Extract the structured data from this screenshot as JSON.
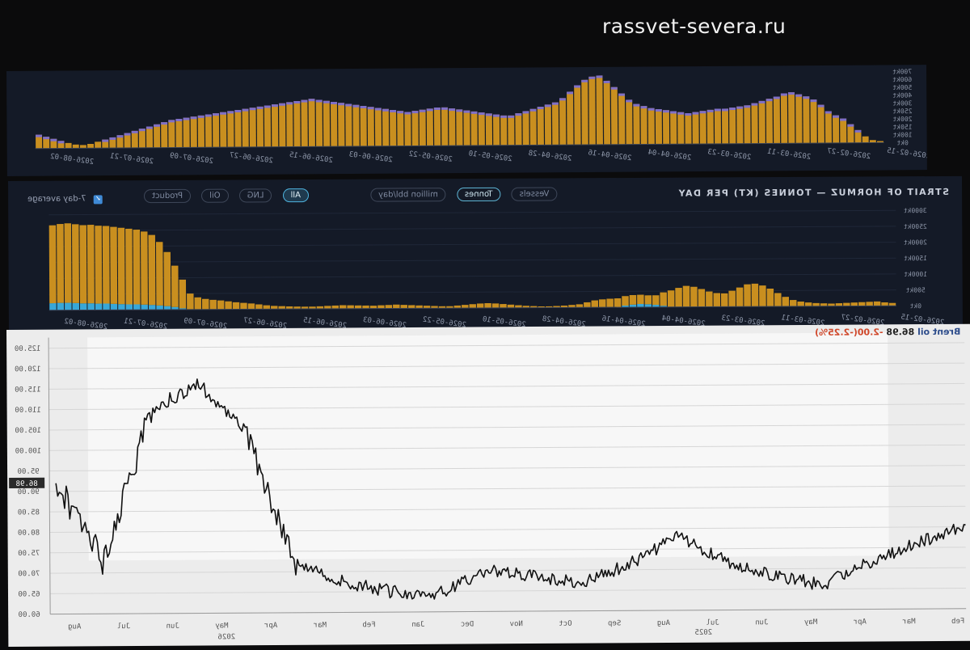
{
  "site": {
    "title": "rassvet-severa.ru"
  },
  "top_chart": {
    "y_ticks": [
      "0kt",
      "100kt",
      "150kt",
      "200kt",
      "250kt",
      "300kt",
      "400kt",
      "500kt",
      "600kt",
      "700kt"
    ],
    "x_ticks": [
      "2026-02-15",
      "2026-02-27",
      "2026-03-11",
      "2026-03-23",
      "2026-04-04",
      "2026-04-16",
      "2026-04-28",
      "2026-05-10",
      "2026-05-22",
      "2026-06-03",
      "2026-06-15",
      "2026-06-27",
      "2026-07-09",
      "2026-07-21",
      "2026-08-02"
    ]
  },
  "mid_chart": {
    "title": "STRAIT OF HORMUZ — TONNES (KT) PER DAY",
    "avg_label": "7-day average",
    "chips": [
      "Vessels",
      "Tonnes",
      "million bbl/day",
      "All",
      "LNG",
      "Oil",
      "Product"
    ],
    "y_ticks": [
      "0kt",
      "500kt",
      "1000kt",
      "1500kt",
      "2000kt",
      "2500kt",
      "3000kt"
    ],
    "x_ticks": [
      "2026-02-15",
      "2026-02-27",
      "2026-03-11",
      "2026-03-23",
      "2026-04-04",
      "2026-04-16",
      "2026-04-28",
      "2026-05-10",
      "2026-05-22",
      "2026-06-03",
      "2026-06-15",
      "2026-06-27",
      "2026-07-09",
      "2026-07-21",
      "2026-08-02"
    ]
  },
  "brent": {
    "name": "Brent oil",
    "price": "86.98",
    "change": "-2.00(-2.25%)",
    "y_ticks": [
      "60.00",
      "65.00",
      "70.00",
      "75.00",
      "80.00",
      "85.00",
      "90.00",
      "95.00",
      "100.00",
      "105.00",
      "110.00",
      "115.00",
      "120.00",
      "125.00"
    ],
    "x_ticks": [
      "Feb",
      "Mar",
      "Apr",
      "May",
      "Jun",
      "Jul",
      "Aug",
      "Sep",
      "Oct",
      "Nov",
      "Dec",
      "Jan",
      "Feb",
      "Mar",
      "Apr",
      "May",
      "Jun",
      "Jul",
      "Aug"
    ],
    "year_labels": [
      "2025",
      "2026"
    ]
  },
  "chart_data": [
    {
      "type": "bar",
      "title": "",
      "xlabel": "",
      "ylabel": "",
      "x_range": [
        "2026-02-15",
        "2026-08-02"
      ],
      "ylim": [
        0,
        700
      ],
      "series": [
        {
          "values": [
            15,
            25,
            60,
            120,
            175,
            230,
            260,
            300,
            360,
            410,
            440,
            460,
            480,
            470,
            440,
            420,
            400,
            380,
            360,
            350,
            340,
            330,
            330,
            320,
            310,
            300,
            290,
            300,
            310,
            320,
            330,
            340,
            360,
            380,
            420,
            480,
            540,
            600,
            650,
            640,
            610,
            560,
            500,
            440,
            400,
            380,
            360,
            340,
            320,
            300,
            280,
            280,
            290,
            300,
            310,
            320,
            330,
            340,
            350,
            360,
            360,
            350,
            340,
            330,
            320,
            330,
            340,
            350,
            360,
            370,
            380,
            390,
            400,
            410,
            420,
            430,
            440,
            450,
            440,
            430,
            420,
            410,
            400,
            390,
            380,
            370,
            360,
            350,
            340,
            330,
            320,
            310,
            300,
            290,
            280,
            270,
            260,
            240,
            220,
            200,
            180,
            160,
            140,
            120,
            100,
            80,
            60,
            40,
            30,
            35,
            50,
            70,
            90,
            110,
            130
          ]
        }
      ]
    },
    {
      "type": "bar",
      "title": "STRAIT OF HORMUZ — TONNES (KT) PER DAY",
      "xlabel": "",
      "ylabel": "",
      "x_range": [
        "2026-02-15",
        "2026-08-02"
      ],
      "ylim": [
        0,
        3000
      ],
      "series": [
        {
          "name": "Oil",
          "values": [
            2450,
            2480,
            2500,
            2480,
            2460,
            2470,
            2450,
            2440,
            2420,
            2400,
            2380,
            2350,
            2300,
            2200,
            2000,
            1700,
            1300,
            900,
            500,
            380,
            330,
            300,
            280,
            250,
            220,
            200,
            180,
            150,
            120,
            100,
            90,
            80,
            75,
            70,
            70,
            80,
            90,
            100,
            110,
            105,
            100,
            95,
            90,
            100,
            110,
            120,
            110,
            100,
            90,
            80,
            70,
            60,
            60,
            80,
            100,
            120,
            140,
            150,
            140,
            120,
            100,
            80,
            60,
            50,
            40,
            40,
            50,
            60,
            80,
            100,
            160,
            220,
            250,
            270,
            280,
            300,
            300,
            290,
            280,
            300,
            420,
            520,
            600,
            660,
            630,
            560,
            480,
            430,
            420,
            500,
            600,
            700,
            720,
            660,
            560,
            420,
            300,
            200,
            150,
            120,
            100,
            90,
            80,
            90,
            100,
            110,
            120,
            130,
            140,
            110,
            90
          ]
        },
        {
          "name": "LNG",
          "values": [
            220,
            230,
            230,
            220,
            210,
            210,
            200,
            200,
            190,
            180,
            170,
            170,
            160,
            150,
            130,
            110,
            80,
            40,
            0,
            0,
            0,
            0,
            0,
            0,
            0,
            0,
            0,
            0,
            0,
            0,
            0,
            0,
            0,
            0,
            0,
            0,
            0,
            0,
            0,
            0,
            0,
            0,
            0,
            0,
            0,
            0,
            0,
            0,
            0,
            0,
            0,
            0,
            0,
            0,
            0,
            0,
            0,
            0,
            0,
            0,
            0,
            0,
            0,
            0,
            0,
            0,
            0,
            0,
            0,
            0,
            0,
            0,
            0,
            0,
            0,
            50,
            80,
            100,
            90,
            70,
            40,
            0,
            0,
            0,
            0,
            0,
            0,
            0,
            0,
            0,
            0,
            0,
            0,
            0,
            0,
            0,
            0,
            0,
            0,
            0,
            0,
            0,
            0,
            0,
            0,
            0,
            0,
            0,
            0,
            0
          ]
        }
      ]
    },
    {
      "type": "line",
      "title": "Brent oil",
      "xlabel": "",
      "ylabel": "",
      "x": [
        "2025-01",
        "2025-02",
        "2025-03",
        "2025-04",
        "2025-05",
        "2025-06",
        "2025-07",
        "2025-08",
        "2025-09",
        "2025-10",
        "2025-11",
        "2025-12",
        "2026-01",
        "2026-02",
        "2026-03",
        "2026-04",
        "2026-05",
        "2026-06",
        "2026-07",
        "2026-08"
      ],
      "ylim": [
        60,
        126
      ],
      "series": [
        {
          "name": "Brent oil",
          "values": [
            80.5,
            76.0,
            71.5,
            66.0,
            68.5,
            72.0,
            78.0,
            71.5,
            67.0,
            68.5,
            70.0,
            64.5,
            65.0,
            67.5,
            72.0,
            104.0,
            116.0,
            110.0,
            72.5,
            92.0
          ]
        }
      ]
    }
  ]
}
